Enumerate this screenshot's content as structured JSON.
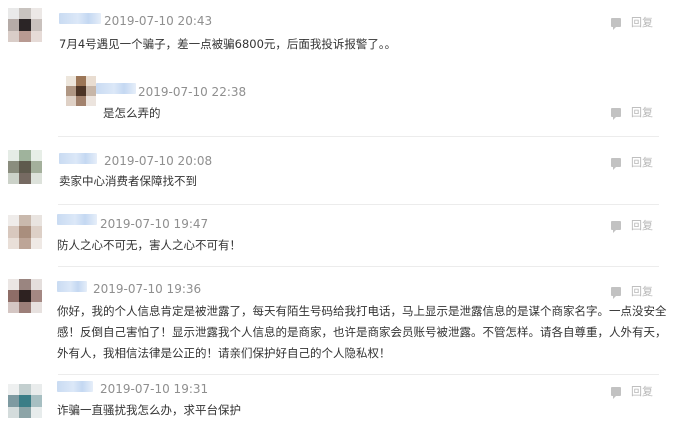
{
  "comments": [
    {
      "time": "2019-07-10 20:43",
      "text": "7月4号遇见一个骗子，差一点被骗6800元，后面我投诉报警了。。",
      "reply_label": "回复",
      "reply": {
        "time": "2019-07-10 22:38",
        "text": "是怎么弄的",
        "reply_label": "回复"
      }
    },
    {
      "time": "2019-07-10 20:08",
      "text": "卖家中心消费者保障找不到",
      "reply_label": "回复"
    },
    {
      "time": "2019-07-10 19:47",
      "text": "防人之心不可无，害人之心不可有！",
      "reply_label": "回复"
    },
    {
      "time": "2019-07-10 19:36",
      "text_lines": [
        "你好，我的个人信息肯定是被泄露了，每天有陌生号码给我打电话，马上显示是泄露信息的是谋个商家名字。一点没安全",
        "感！反倒自己害怕了！显示泄露我个人信息的是商家，也许是商家会员账号被泄露。不管怎样。请各自尊重，人外有天，",
        "外有人，我相信法律是公正的！请亲们保护好自己的个人隐私权！"
      ],
      "reply_label": "回复"
    },
    {
      "time": "2019-07-10 19:31",
      "text": "诈骗一直骚扰我怎么办，求平台保护",
      "reply_label": "回复"
    }
  ]
}
